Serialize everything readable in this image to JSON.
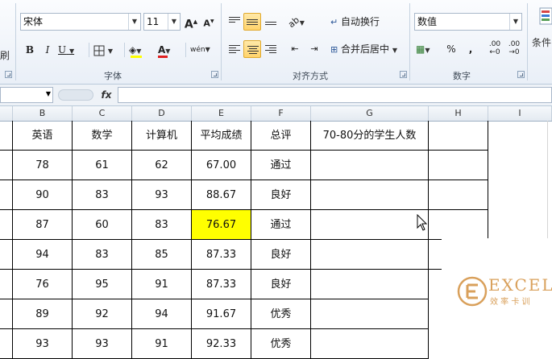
{
  "ribbon": {
    "font": {
      "font_name": "宋体",
      "font_size": "11",
      "bold": "B",
      "italic": "I",
      "underline": "U",
      "phonetic": "wén",
      "group_label": "字体"
    },
    "alignment": {
      "wrap_text": "自动换行",
      "merge_center": "合并后居中",
      "group_label": "对齐方式"
    },
    "number": {
      "format": "数值",
      "percent": "%",
      "comma": ",",
      "inc_decimal": ".00",
      "dec_decimal": ".00",
      "group_label": "数字"
    },
    "styles": {
      "conditional": "条件"
    },
    "clipboard_tail": "刷"
  },
  "formula_bar": {
    "fx": "fx",
    "name_box": "",
    "content": ""
  },
  "columns": [
    "B",
    "C",
    "D",
    "E",
    "F",
    "G",
    "H",
    "I"
  ],
  "table": {
    "headers": [
      "英语",
      "数学",
      "计算机",
      "平均成绩",
      "总评",
      "70-80分的学生人数"
    ],
    "rows": [
      [
        "78",
        "61",
        "62",
        "67.00",
        "通过",
        ""
      ],
      [
        "90",
        "83",
        "93",
        "88.67",
        "良好",
        ""
      ],
      [
        "87",
        "60",
        "83",
        "76.67",
        "通过",
        ""
      ],
      [
        "94",
        "83",
        "85",
        "87.33",
        "良好",
        ""
      ],
      [
        "76",
        "95",
        "91",
        "87.33",
        "良好",
        ""
      ],
      [
        "89",
        "92",
        "94",
        "91.67",
        "优秀",
        ""
      ],
      [
        "93",
        "93",
        "91",
        "92.33",
        "优秀",
        ""
      ]
    ],
    "highlight_color": "#ffff00"
  },
  "watermark": {
    "brand": "EXCEL",
    "sub": "效 率 卡 训",
    "color": "#d9a05b"
  }
}
